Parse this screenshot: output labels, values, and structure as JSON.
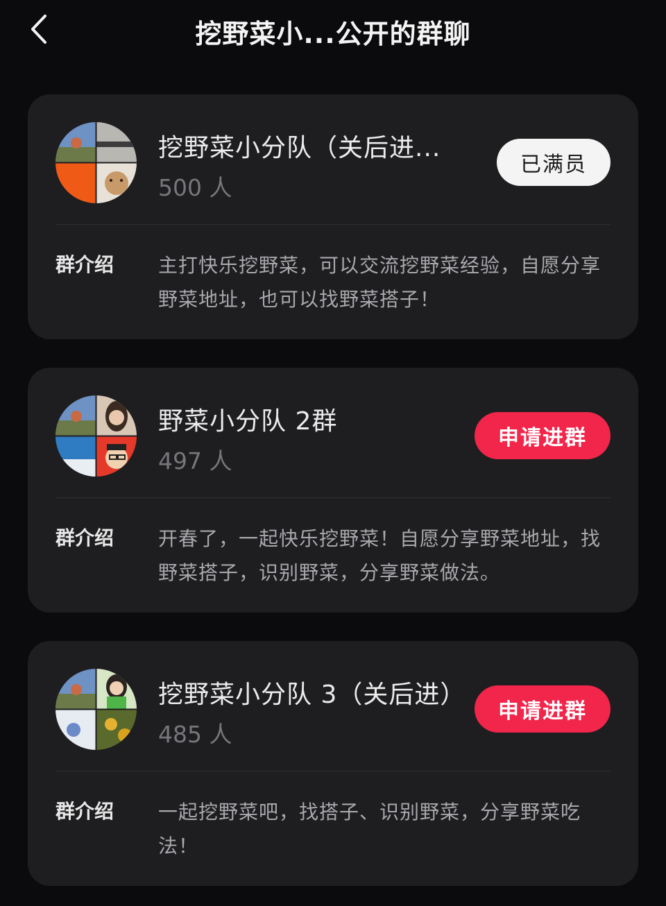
{
  "header": {
    "title": "挖野菜小...公开的群聊"
  },
  "groups": [
    {
      "name": "挖野菜小分队（关后进...",
      "members": "500 人",
      "button": "已满员",
      "button_state": "full",
      "intro_label": "群介绍",
      "intro": "主打快乐挖野菜，可以交流挖野菜经验，自愿分享野菜地址，也可以找野菜搭子！"
    },
    {
      "name": "野菜小分队 2群",
      "members": "497 人",
      "button": "申请进群",
      "button_state": "apply",
      "intro_label": "群介绍",
      "intro": "开春了，一起快乐挖野菜！自愿分享野菜地址，找野菜搭子，识别野菜，分享野菜做法。"
    },
    {
      "name": "挖野菜小分队 3（关后进）",
      "members": "485 人",
      "button": "申请进群",
      "button_state": "apply",
      "intro_label": "群介绍",
      "intro": "一起挖野菜吧，找搭子、识别野菜，分享野菜吃法！"
    }
  ],
  "colors": {
    "background": "#0b0b0d",
    "card": "#1e1e21",
    "apply_button": "#f2254a",
    "full_button": "#f4f4f4",
    "member_count": "#77777b"
  }
}
